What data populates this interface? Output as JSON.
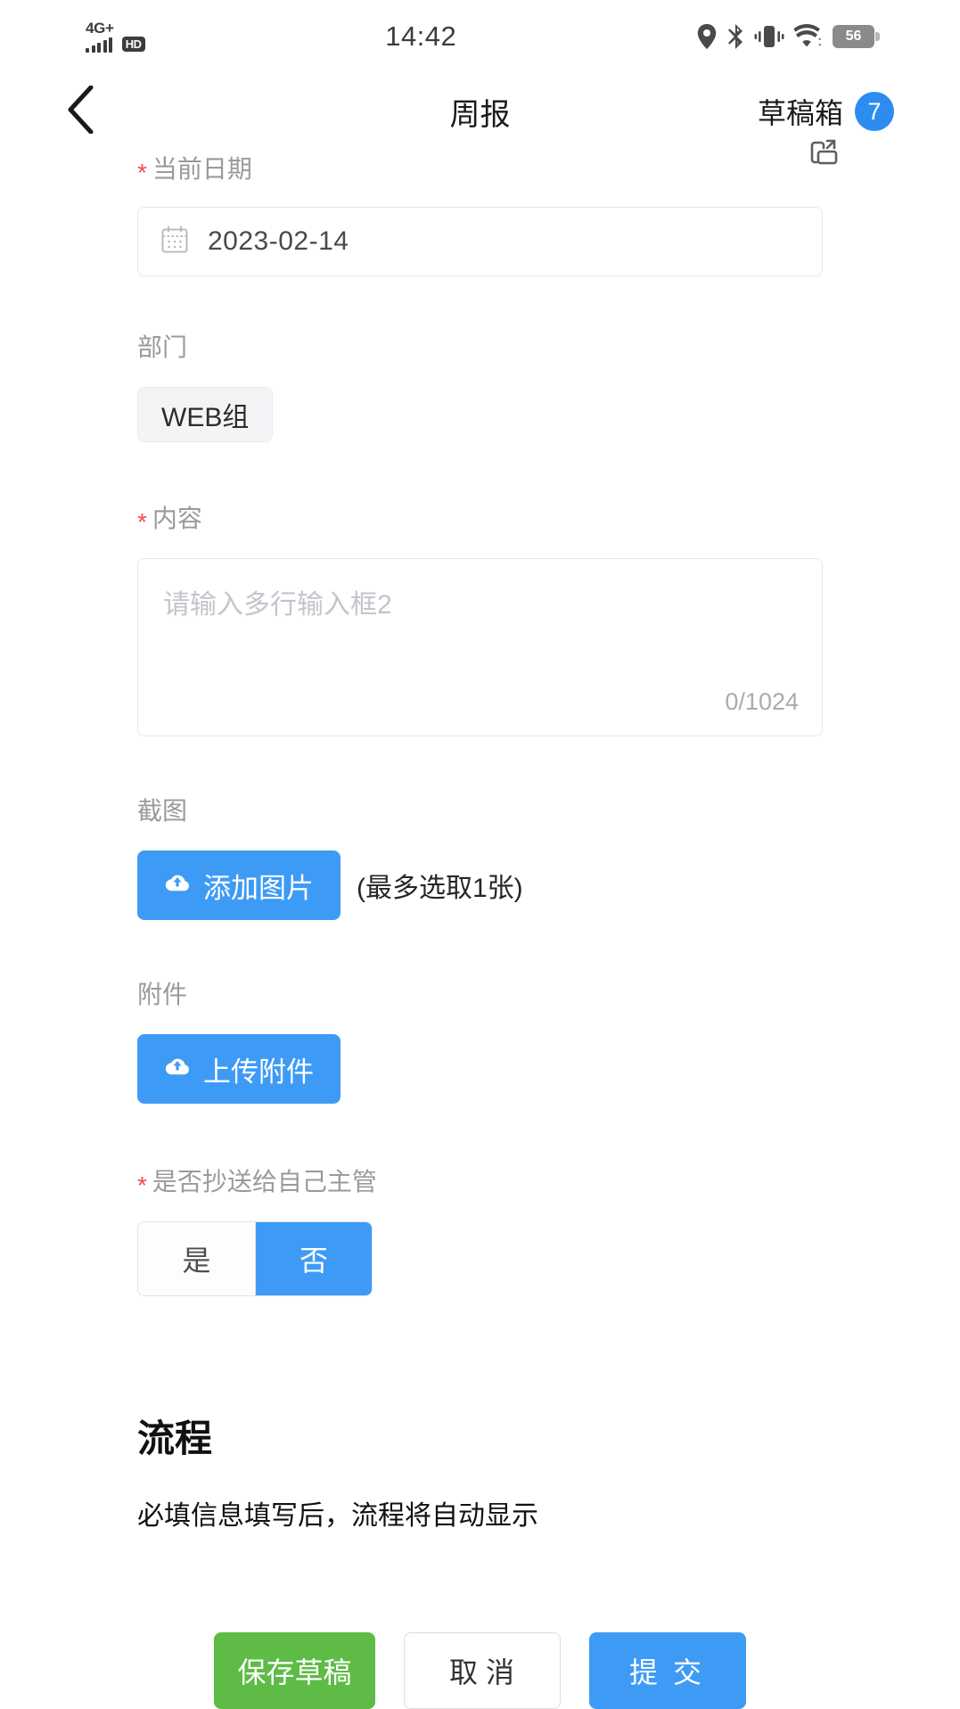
{
  "status_bar": {
    "network_label": "4G+",
    "hd_label": "HD",
    "time": "14:42",
    "battery_percent": "56",
    "icons": [
      "signal-icon",
      "hd-icon",
      "location-icon",
      "bluetooth-icon",
      "vibrate-icon",
      "wifi-icon",
      "battery-icon"
    ]
  },
  "header": {
    "back_icon": "back-chevron-icon",
    "title": "周报",
    "drafts_label": "草稿箱",
    "drafts_count": "7"
  },
  "form": {
    "export_icon": "export-folder-icon",
    "date": {
      "required_mark": "*",
      "label": "当前日期",
      "value": "2023-02-14",
      "icon": "calendar-icon"
    },
    "department": {
      "label": "部门",
      "value": "WEB组"
    },
    "content": {
      "required_mark": "*",
      "label": "内容",
      "placeholder": "请输入多行输入框2",
      "value": "",
      "counter": "0/1024"
    },
    "screenshot": {
      "label": "截图",
      "button_label": "添加图片",
      "button_icon": "cloud-upload-icon",
      "hint": "(最多选取1张)"
    },
    "attachment": {
      "label": "附件",
      "button_label": "上传附件",
      "button_icon": "cloud-upload-icon"
    },
    "cc_manager": {
      "required_mark": "*",
      "label": "是否抄送给自己主管",
      "options": [
        "是",
        "否"
      ],
      "selected": "否"
    }
  },
  "flow": {
    "title": "流程",
    "description": "必填信息填写后，流程将自动显示"
  },
  "footer": {
    "save_draft_label": "保存草稿",
    "cancel_label": "取 消",
    "submit_label": "提 交"
  },
  "colors": {
    "primary_blue": "#3e9bf5",
    "badge_blue": "#2d8cf0",
    "green": "#5dbb46",
    "required_red": "#ed4d4d",
    "label_gray": "#9a9a9a"
  }
}
